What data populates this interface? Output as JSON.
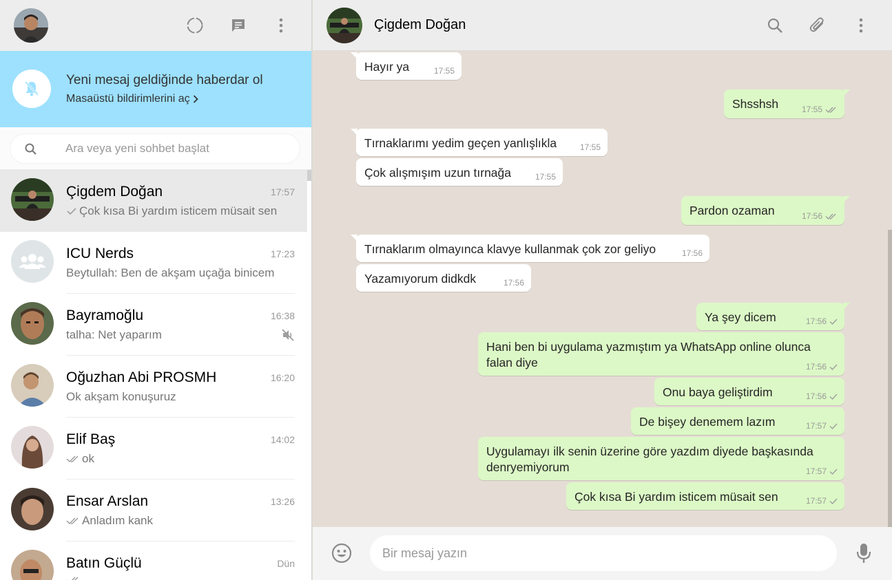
{
  "sidebar": {
    "notification": {
      "title": "Yeni mesaj geldiğinde haberdar ol",
      "link": "Masaüstü bildirimlerini aç"
    },
    "search": {
      "placeholder": "Ara veya yeni sohbet başlat"
    },
    "chats": [
      {
        "name": "Çigdem Doğan",
        "time": "17:57",
        "preview": "Çok kısa Bi yardım isticem müsait sen",
        "status": "sent",
        "active": true,
        "avatar_color": "#3a4a3a"
      },
      {
        "name": "ICU Nerds",
        "time": "17:23",
        "preview": "Beytullah: Ben de akşam uçağa binicem",
        "status": "none",
        "group": true,
        "avatar_color": "#dfe5e7"
      },
      {
        "name": "Bayramoğlu",
        "time": "16:38",
        "preview": "talha: Net yaparım",
        "status": "none",
        "muted": true,
        "avatar_color": "#7a5a3f"
      },
      {
        "name": "Oğuzhan Abi PROSMH",
        "time": "16:20",
        "preview": "Ok akşam konuşuruz",
        "status": "none",
        "avatar_color": "#b08a62"
      },
      {
        "name": "Elif Baş",
        "time": "14:02",
        "preview": "ok",
        "status": "delivered",
        "avatar_color": "#c4a38f"
      },
      {
        "name": "Ensar Arslan",
        "time": "13:26",
        "preview": "Anladım kank",
        "status": "delivered",
        "avatar_color": "#5d4a3d"
      },
      {
        "name": "Batın Güçlü",
        "time": "Dün",
        "preview": "",
        "status": "delivered",
        "avatar_color": "#8a6c52"
      }
    ]
  },
  "conversation": {
    "contact_name": "Çigdem Doğan",
    "messages": [
      {
        "dir": "in",
        "text": "Hayır ya",
        "time": "17:55"
      },
      {
        "dir": "out",
        "text": "Shsshsh",
        "time": "17:55",
        "status": "delivered"
      },
      {
        "dir": "in",
        "text": "Tırnaklarımı yedim geçen yanlışlıkla",
        "time": "17:55"
      },
      {
        "dir": "in",
        "text": "Çok alışmışım uzun tırnağa",
        "time": "17:55"
      },
      {
        "dir": "out",
        "text": "Pardon ozaman",
        "time": "17:56",
        "status": "delivered"
      },
      {
        "dir": "in",
        "text": "Tırnaklarım olmayınca klavye kullanmak çok zor geliyo",
        "time": "17:56"
      },
      {
        "dir": "in",
        "text": "Yazamıyorum didkdk",
        "time": "17:56"
      },
      {
        "dir": "out",
        "text": "Ya şey dicem",
        "time": "17:56",
        "status": "sent"
      },
      {
        "dir": "out",
        "text": "Hani ben bi uygulama yazmıştım ya WhatsApp online olunca",
        "text2": "falan diye",
        "time": "17:56",
        "status": "sent"
      },
      {
        "dir": "out",
        "text": "Onu baya geliştirdim",
        "time": "17:56",
        "status": "sent"
      },
      {
        "dir": "out",
        "text": "De bişey denemem lazım",
        "time": "17:57",
        "status": "sent"
      },
      {
        "dir": "out",
        "text": "Uygulamayı ilk senin üzerine göre yazdım diyede başkasında",
        "text2": "denryemiyorum",
        "time": "17:57",
        "status": "sent"
      },
      {
        "dir": "out",
        "text": "Çok kısa Bi yardım isticem müsait sen",
        "time": "17:57",
        "status": "sent"
      }
    ]
  },
  "composer": {
    "placeholder": "Bir mesaj yazın"
  },
  "colors": {
    "header_bg": "#ededed",
    "notification_bg": "#9de1fe",
    "chat_bg": "#e5ddd5",
    "outgoing_bubble": "#dcf8c6",
    "incoming_bubble": "#ffffff",
    "tick_grey": "#9e9e9e"
  },
  "icons": {
    "header": [
      "status-icon",
      "new-chat-icon",
      "menu-icon"
    ],
    "chat_header": [
      "search-icon",
      "attach-icon",
      "menu-icon"
    ],
    "composer": [
      "emoji-icon",
      "mic-icon"
    ]
  }
}
